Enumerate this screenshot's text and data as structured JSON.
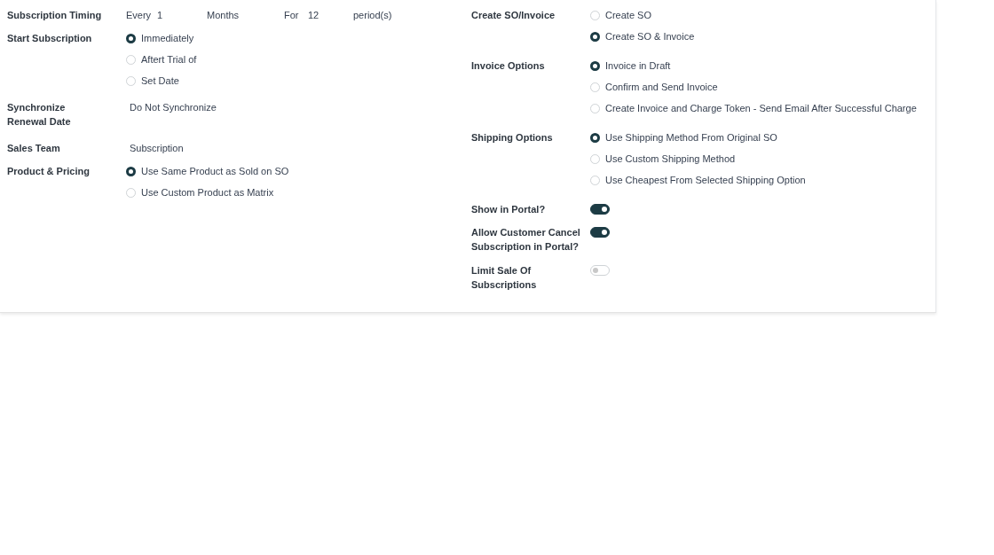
{
  "left": [
    {
      "label": "Subscription Timing",
      "kind": "timing",
      "timing": {
        "every_label": "Every",
        "interval": "1",
        "unit": "Months",
        "for_label": "For",
        "count": "12",
        "suffix": "period(s)"
      }
    },
    {
      "label": "Start Subscription",
      "kind": "radio",
      "options": [
        {
          "label": "Immediately",
          "selected": true
        },
        {
          "label": "Aftert Trial of",
          "selected": false
        },
        {
          "label": "Set Date",
          "selected": false
        }
      ]
    },
    {
      "label": "Synchronize Renewal Date",
      "kind": "text",
      "value": "Do Not Synchronize"
    },
    {
      "label": "Sales Team",
      "kind": "text",
      "value": "Subscription"
    },
    {
      "label": "Product & Pricing",
      "kind": "radio",
      "options": [
        {
          "label": "Use Same Product as Sold on SO",
          "selected": true
        },
        {
          "label": "Use Custom Product as Matrix",
          "selected": false
        }
      ]
    }
  ],
  "right": [
    {
      "label": "Create SO/Invoice",
      "kind": "radio",
      "options": [
        {
          "label": "Create SO",
          "selected": false
        },
        {
          "label": "Create SO & Invoice",
          "selected": true
        }
      ]
    },
    {
      "label": "Invoice Options",
      "kind": "radio",
      "options": [
        {
          "label": "Invoice in Draft",
          "selected": true
        },
        {
          "label": "Confirm and Send Invoice",
          "selected": false
        },
        {
          "label": "Create Invoice and Charge Token - Send Email After Successful Charge",
          "selected": false
        }
      ]
    },
    {
      "label": "Shipping Options",
      "kind": "radio",
      "options": [
        {
          "label": "Use Shipping Method From Original SO",
          "selected": true
        },
        {
          "label": "Use Custom Shipping Method",
          "selected": false
        },
        {
          "label": "Use Cheapest From Selected Shipping Option",
          "selected": false
        }
      ]
    },
    {
      "label": "Show in Portal?",
      "kind": "toggle",
      "on": true
    },
    {
      "label": "Allow Customer Cancel Subscription in Portal?",
      "kind": "toggle",
      "on": true
    },
    {
      "label": "Limit Sale Of Subscriptions",
      "kind": "toggle",
      "on": false
    }
  ]
}
